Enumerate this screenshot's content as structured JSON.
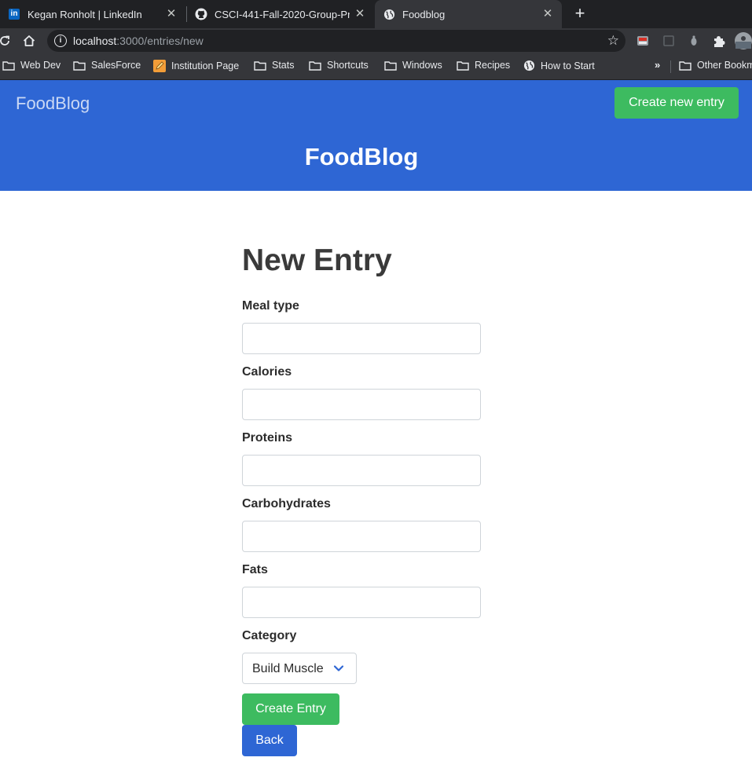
{
  "browser": {
    "tabs": [
      {
        "title": "Kegan Ronholt | LinkedIn",
        "icon": "linkedin-icon"
      },
      {
        "title": "CSCI-441-Fall-2020-Group-Pr",
        "icon": "github-icon"
      },
      {
        "title": "Foodblog",
        "icon": "globe-icon",
        "active": true
      }
    ],
    "url_host": "localhost",
    "url_path": ":3000/entries/new",
    "bookmarks": [
      {
        "label": "Web Dev",
        "icon": "folder-icon"
      },
      {
        "label": "SalesForce",
        "icon": "folder-icon"
      },
      {
        "label": "Institution Page",
        "icon": "pencil-icon"
      },
      {
        "label": "Stats",
        "icon": "folder-icon"
      },
      {
        "label": "Shortcuts",
        "icon": "folder-icon"
      },
      {
        "label": "Windows",
        "icon": "folder-icon"
      },
      {
        "label": "Recipes",
        "icon": "folder-icon"
      },
      {
        "label": "How to Start",
        "icon": "globe-icon"
      }
    ],
    "bookmarks_more": "»",
    "other_bookmarks": "Other Bookm"
  },
  "navbar": {
    "brand": "FoodBlog",
    "new_entry_button": "Create new entry"
  },
  "hero": {
    "title": "FoodBlog"
  },
  "form": {
    "title": "New Entry",
    "fields": [
      {
        "label": "Meal type",
        "value": ""
      },
      {
        "label": "Calories",
        "value": ""
      },
      {
        "label": "Proteins",
        "value": ""
      },
      {
        "label": "Carbohydrates",
        "value": ""
      },
      {
        "label": "Fats",
        "value": ""
      }
    ],
    "category_label": "Category",
    "category_selected": "Build Muscle",
    "submit_button": "Create Entry",
    "back_button": "Back"
  },
  "colors": {
    "primary": "#2e66d4",
    "success": "#3dbb60",
    "chrome_dark": "#202124",
    "chrome_toolbar": "#35363a"
  }
}
